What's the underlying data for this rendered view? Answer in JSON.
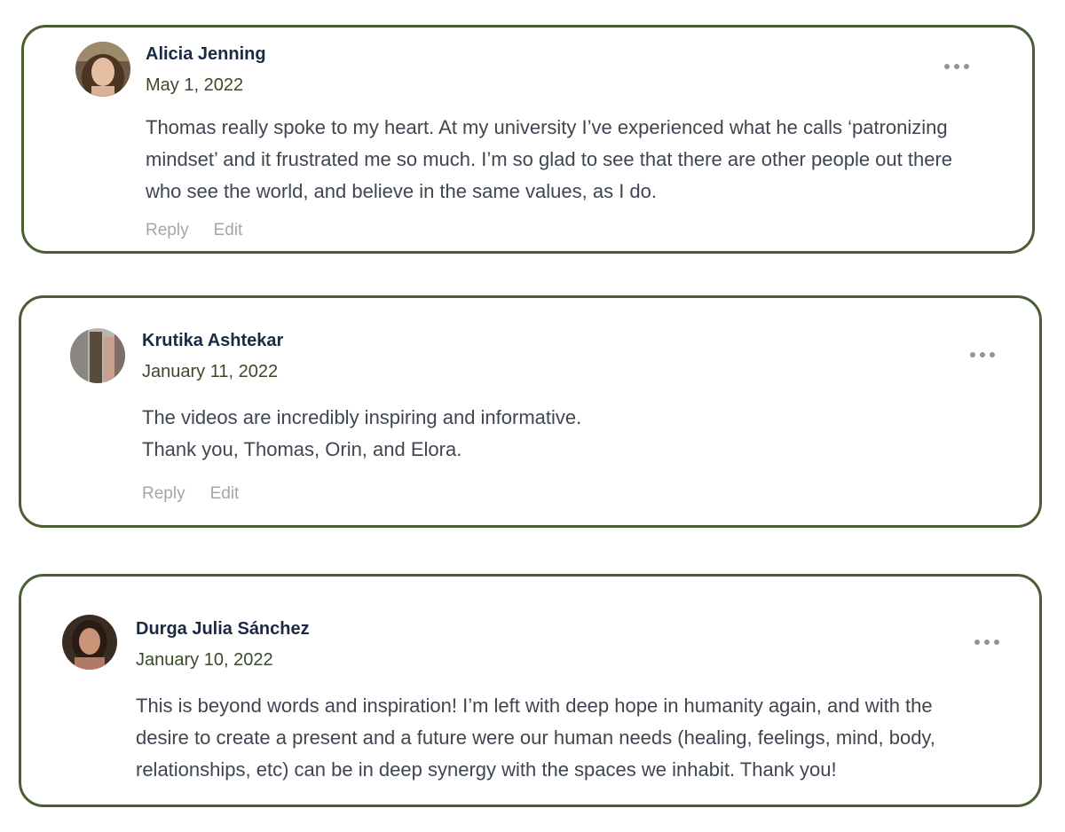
{
  "comments": [
    {
      "author": "Alicia Jenning",
      "date": "May 1, 2022",
      "lines": [
        "Thomas really spoke to my heart. At my university I’ve experienced what he calls ‘patronizing",
        "mindset’ and it frustrated me so much. I’m so glad to see that there are other people out there",
        "who see the world, and believe in the same values, as I do."
      ],
      "reply_label": "Reply",
      "edit_label": "Edit",
      "more_icon": "more-horizontal-icon"
    },
    {
      "author": "Krutika Ashtekar",
      "date": "January 11, 2022",
      "lines": [
        "The videos are incredibly inspiring and informative.",
        "Thank you, Thomas, Orin, and Elora."
      ],
      "reply_label": "Reply",
      "edit_label": "Edit",
      "more_icon": "more-horizontal-icon"
    },
    {
      "author": "Durga Julia Sánchez",
      "date": "January 10, 2022",
      "lines": [
        "This is beyond words and inspiration! I’m left with deep hope in humanity again, and with the",
        "desire to create a present and a future were our human needs (healing, feelings, mind, body,",
        "relationships, etc) can be in deep synergy with the spaces we inhabit. Thank you!"
      ],
      "more_icon": "more-horizontal-icon"
    }
  ],
  "colors": {
    "card_border": "#4a5e34",
    "author": "#1b2a44",
    "date": "#3a4a28",
    "body": "#3f4651",
    "action": "#a6a6a6"
  }
}
